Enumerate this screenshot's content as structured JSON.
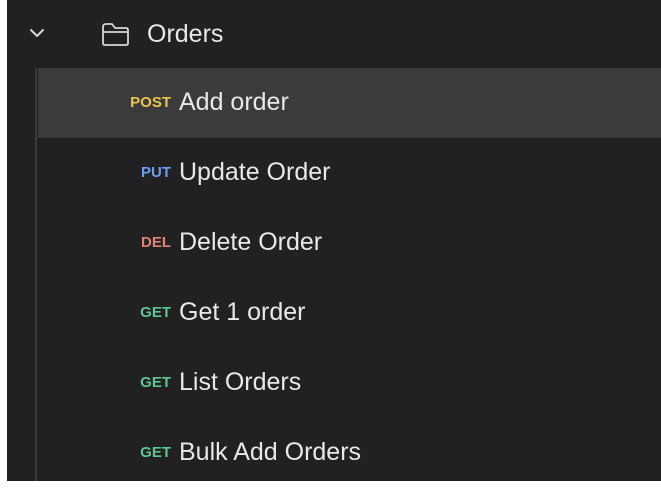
{
  "colors": {
    "background": "#212121",
    "selected_row": "#3b3b3b",
    "text": "#e8e8e8",
    "post": "#e8c64a",
    "put": "#6b9ff0",
    "del": "#e0837a",
    "get": "#5ec492"
  },
  "folder": {
    "label": "Orders",
    "expanded": true,
    "toggle_icon": "chevron-down-icon",
    "icon": "folder-icon"
  },
  "requests": [
    {
      "method": "POST",
      "method_color": "#e8c64a",
      "label": "Add order",
      "selected": true
    },
    {
      "method": "PUT",
      "method_color": "#6b9ff0",
      "label": "Update Order",
      "selected": false
    },
    {
      "method": "DEL",
      "method_color": "#e0837a",
      "label": "Delete Order",
      "selected": false
    },
    {
      "method": "GET",
      "method_color": "#5ec492",
      "label": "Get 1 order",
      "selected": false
    },
    {
      "method": "GET",
      "method_color": "#5ec492",
      "label": "List Orders",
      "selected": false
    },
    {
      "method": "GET",
      "method_color": "#5ec492",
      "label": "Bulk Add Orders",
      "selected": false
    }
  ]
}
